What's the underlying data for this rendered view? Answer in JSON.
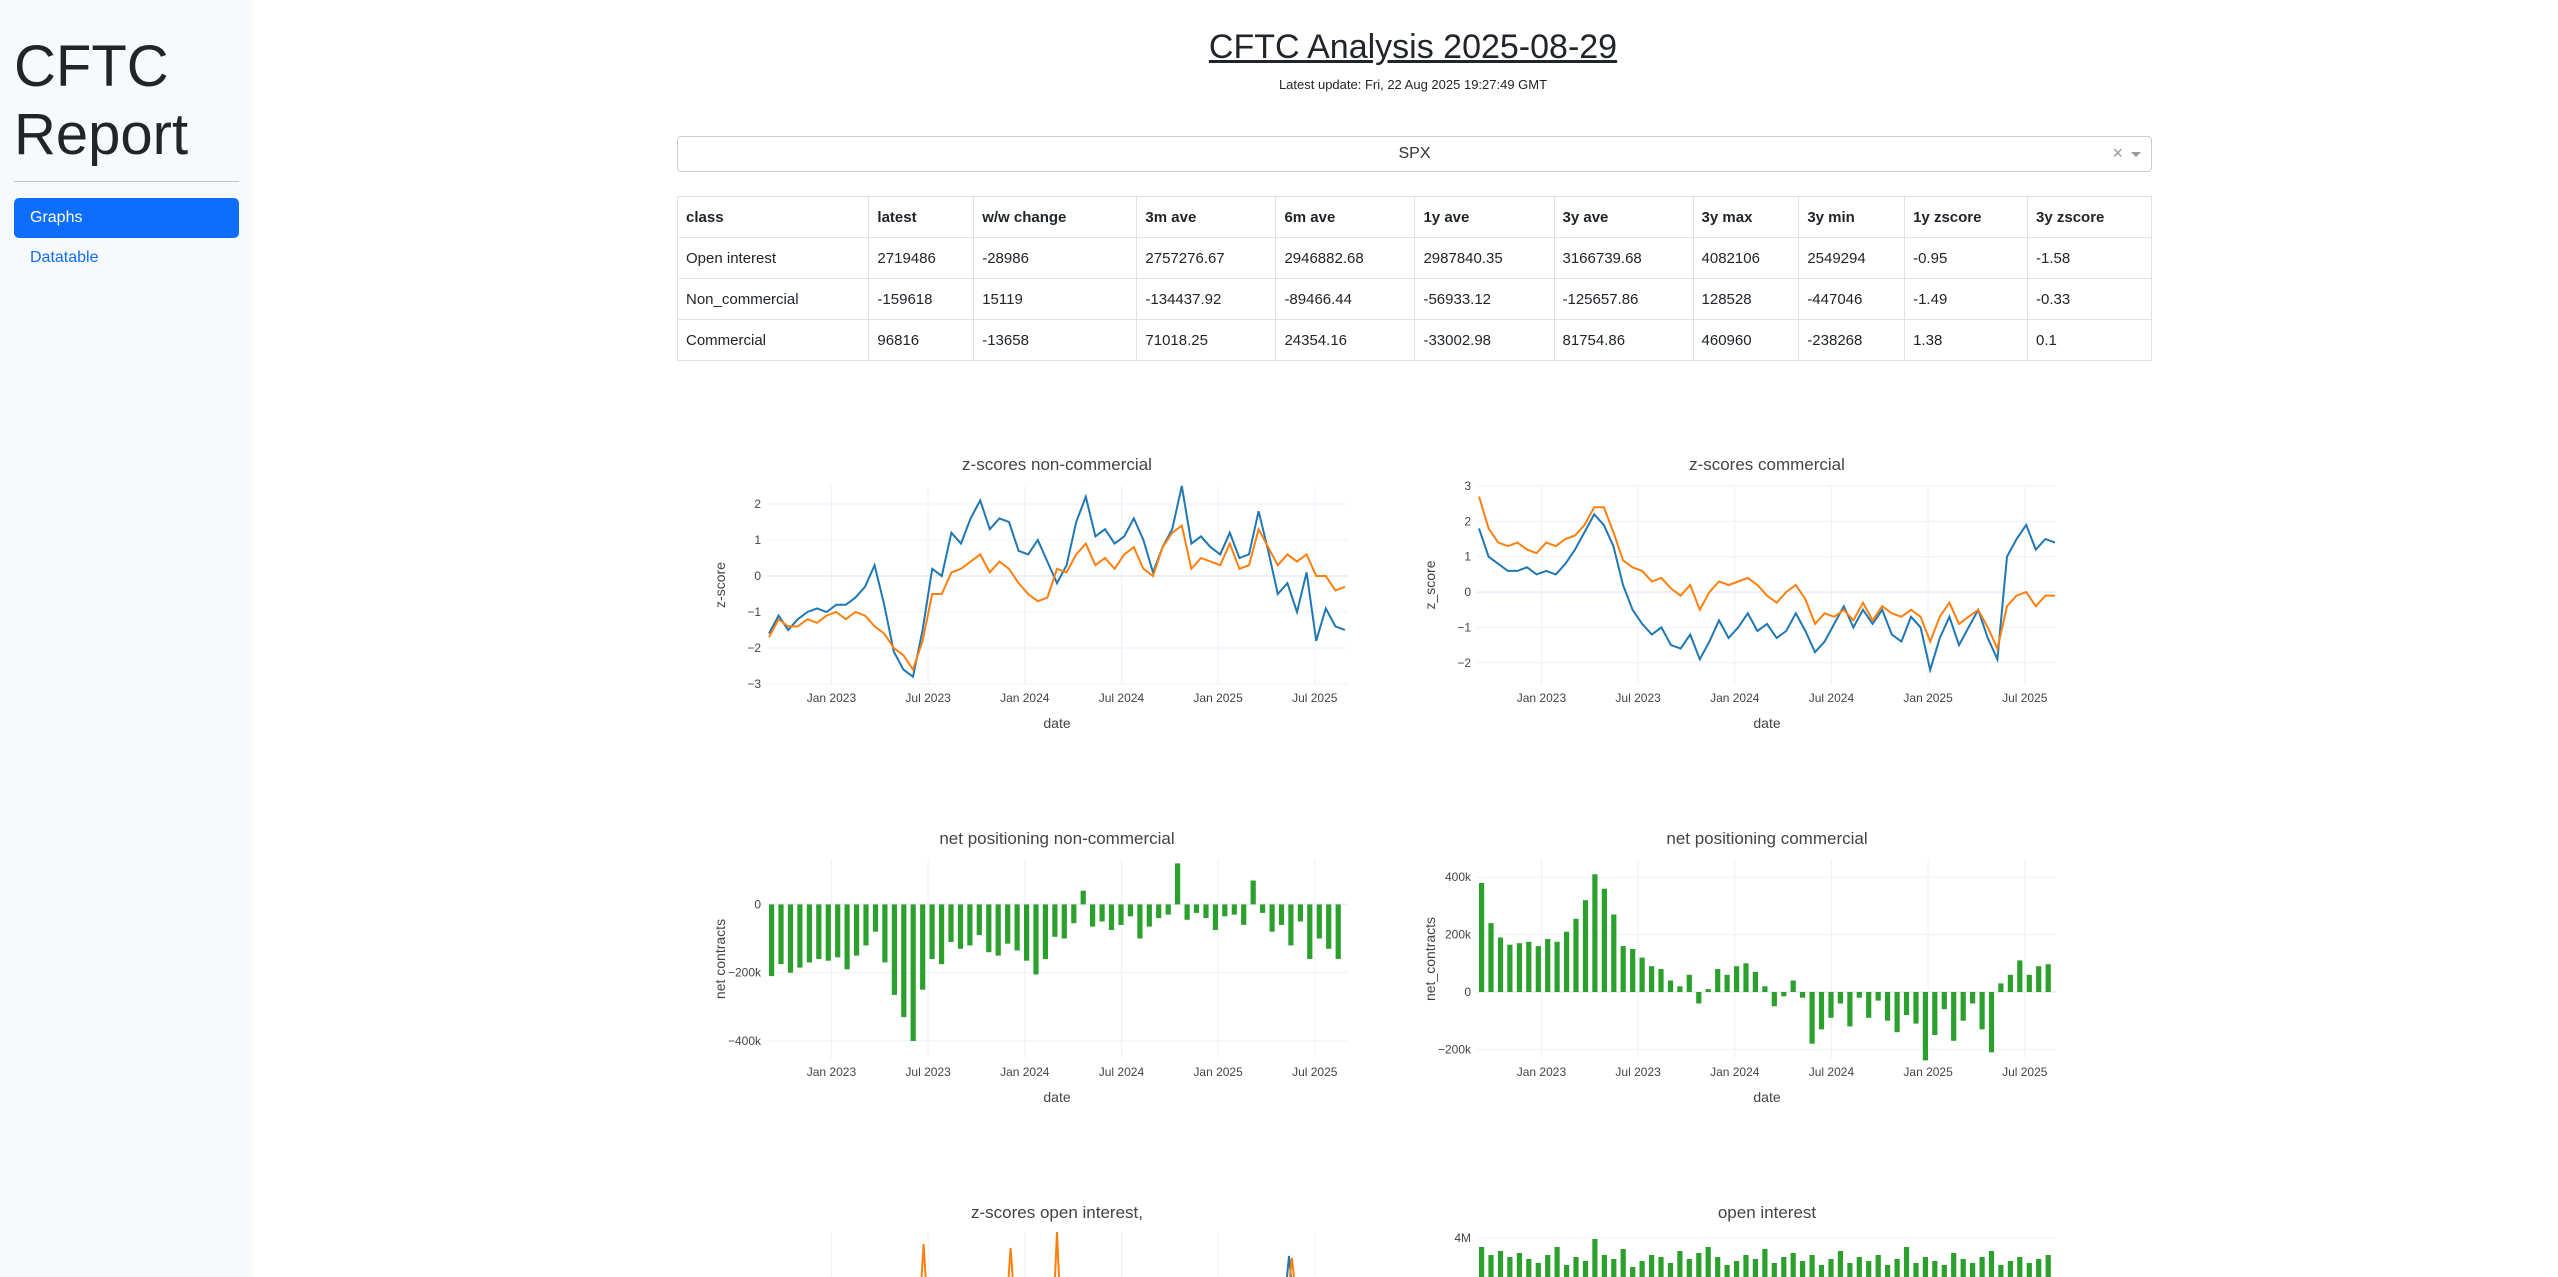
{
  "sidebar": {
    "brand_line1": "CFTC",
    "brand_line2": "Report",
    "items": [
      {
        "label": "Graphs",
        "active": true
      },
      {
        "label": "Datatable",
        "active": false
      }
    ]
  },
  "header": {
    "title": "CFTC Analysis 2025-08-29",
    "subtitle": "Latest update: Fri, 22 Aug 2025 19:27:49 GMT"
  },
  "selector": {
    "value": "SPX",
    "clear": "×"
  },
  "table": {
    "columns": [
      "class",
      "latest",
      "w/w change",
      "3m ave",
      "6m ave",
      "1y ave",
      "3y ave",
      "3y max",
      "3y min",
      "1y zscore",
      "3y zscore"
    ],
    "rows": [
      [
        "Open interest",
        "2719486",
        "-28986",
        "2757276.67",
        "2946882.68",
        "2987840.35",
        "3166739.68",
        "4082106",
        "2549294",
        "-0.95",
        "-1.58"
      ],
      [
        "Non_commercial",
        "-159618",
        "15119",
        "-134437.92",
        "-89466.44",
        "-56933.12",
        "-125657.86",
        "128528",
        "-447046",
        "-1.49",
        "-0.33"
      ],
      [
        "Commercial",
        "96816",
        "-13658",
        "71018.25",
        "24354.16",
        "-33002.98",
        "81754.86",
        "460960",
        "-238268",
        "1.38",
        "0.1"
      ]
    ]
  },
  "colors": {
    "blue": "#1f77b4",
    "orange": "#ff7f0e",
    "green": "#2ca02c",
    "primary": "#0d6efd"
  },
  "chart_data": [
    {
      "type": "line",
      "title": "z-scores non-commercial",
      "xlabel": "date",
      "ylabel": "z-score",
      "ylim": [
        -3,
        2.5
      ],
      "yticks": [
        -3,
        -2,
        -1,
        0,
        1,
        2
      ],
      "ytick_labels": [
        "−3",
        "−2",
        "−1",
        "0",
        "1",
        "2"
      ],
      "xtick_labels": [
        "Jan 2023",
        "Jul 2023",
        "Jan 2024",
        "Jul 2024",
        "Jan 2025",
        "Jul 2025"
      ],
      "xrange": [
        "2022-09",
        "2025-09"
      ],
      "series": [
        {
          "color": "#1f77b4",
          "values": [
            -1.6,
            -1.1,
            -1.5,
            -1.2,
            -1.0,
            -0.9,
            -1.0,
            -0.8,
            -0.8,
            -0.6,
            -0.3,
            0.3,
            -0.8,
            -2.1,
            -2.6,
            -2.8,
            -1.5,
            0.2,
            0.0,
            1.2,
            0.9,
            1.6,
            2.1,
            1.3,
            1.6,
            1.5,
            0.7,
            0.6,
            1.0,
            0.4,
            -0.2,
            0.3,
            1.5,
            2.2,
            1.1,
            1.3,
            0.9,
            1.1,
            1.6,
            1.0,
            0.1,
            0.8,
            1.3,
            2.5,
            0.9,
            1.1,
            0.8,
            0.6,
            1.2,
            0.5,
            0.6,
            1.8,
            0.7,
            -0.5,
            -0.2,
            -1.0,
            0.1,
            -1.8,
            -0.9,
            -1.4,
            -1.5
          ]
        },
        {
          "color": "#ff7f0e",
          "values": [
            -1.7,
            -1.2,
            -1.4,
            -1.4,
            -1.2,
            -1.3,
            -1.1,
            -1.0,
            -1.2,
            -1.0,
            -1.1,
            -1.4,
            -1.6,
            -2.0,
            -2.2,
            -2.6,
            -1.8,
            -0.5,
            -0.5,
            0.1,
            0.2,
            0.4,
            0.6,
            0.1,
            0.4,
            0.2,
            -0.2,
            -0.5,
            -0.7,
            -0.6,
            0.2,
            0.1,
            0.6,
            0.9,
            0.3,
            0.5,
            0.2,
            0.6,
            0.8,
            0.2,
            0.0,
            0.8,
            1.2,
            1.4,
            0.2,
            0.5,
            0.4,
            0.3,
            0.9,
            0.2,
            0.3,
            1.3,
            0.8,
            0.3,
            0.6,
            0.4,
            0.6,
            0.0,
            0.0,
            -0.4,
            -0.3
          ]
        }
      ]
    },
    {
      "type": "line",
      "title": "z-scores commercial",
      "xlabel": "date",
      "ylabel": "z_score",
      "ylim": [
        -2.6,
        3
      ],
      "yticks": [
        -2,
        -1,
        0,
        1,
        2,
        3
      ],
      "ytick_labels": [
        "−2",
        "−1",
        "0",
        "1",
        "2",
        "3"
      ],
      "xtick_labels": [
        "Jan 2023",
        "Jul 2023",
        "Jan 2024",
        "Jul 2024",
        "Jan 2025",
        "Jul 2025"
      ],
      "xrange": [
        "2022-09",
        "2025-09"
      ],
      "series": [
        {
          "color": "#1f77b4",
          "values": [
            1.8,
            1.0,
            0.8,
            0.6,
            0.6,
            0.7,
            0.5,
            0.6,
            0.5,
            0.8,
            1.2,
            1.7,
            2.2,
            1.9,
            1.3,
            0.2,
            -0.5,
            -0.9,
            -1.2,
            -1.0,
            -1.5,
            -1.6,
            -1.2,
            -1.9,
            -1.4,
            -0.8,
            -1.3,
            -1.0,
            -0.6,
            -1.1,
            -0.9,
            -1.3,
            -1.1,
            -0.6,
            -1.1,
            -1.7,
            -1.4,
            -0.9,
            -0.4,
            -1.0,
            -0.5,
            -0.9,
            -0.5,
            -1.2,
            -1.4,
            -0.7,
            -1.0,
            -2.2,
            -1.3,
            -0.7,
            -1.5,
            -1.0,
            -0.5,
            -1.3,
            -1.9,
            1.0,
            1.5,
            1.9,
            1.2,
            1.5,
            1.4
          ]
        },
        {
          "color": "#ff7f0e",
          "values": [
            2.7,
            1.8,
            1.4,
            1.3,
            1.4,
            1.2,
            1.1,
            1.4,
            1.3,
            1.5,
            1.6,
            1.9,
            2.4,
            2.4,
            1.7,
            0.9,
            0.7,
            0.6,
            0.3,
            0.4,
            0.1,
            -0.1,
            0.2,
            -0.5,
            0.0,
            0.3,
            0.2,
            0.3,
            0.4,
            0.2,
            -0.1,
            -0.3,
            0.0,
            0.2,
            -0.2,
            -0.9,
            -0.6,
            -0.7,
            -0.5,
            -0.8,
            -0.3,
            -0.8,
            -0.4,
            -0.6,
            -0.7,
            -0.5,
            -0.7,
            -1.4,
            -0.7,
            -0.3,
            -0.9,
            -0.7,
            -0.5,
            -1.0,
            -1.6,
            -0.4,
            -0.1,
            0.0,
            -0.4,
            -0.1,
            -0.1
          ]
        }
      ]
    },
    {
      "type": "bar",
      "title": "net positioning non-commercial",
      "xlabel": "date",
      "ylabel": "net contracts",
      "ylim": [
        -450000,
        130000
      ],
      "yticks": [
        -400000,
        -200000,
        0
      ],
      "ytick_labels": [
        "−400k",
        "−200k",
        "0"
      ],
      "xtick_labels": [
        "Jan 2023",
        "Jul 2023",
        "Jan 2024",
        "Jul 2024",
        "Jan 2025",
        "Jul 2025"
      ],
      "xrange": [
        "2022-09",
        "2025-09"
      ],
      "series": [
        {
          "color": "#2ca02c",
          "values": [
            -210000,
            -175000,
            -200000,
            -185000,
            -170000,
            -160000,
            -165000,
            -155000,
            -190000,
            -150000,
            -120000,
            -80000,
            -170000,
            -265000,
            -330000,
            -400000,
            -250000,
            -160000,
            -175000,
            -110000,
            -130000,
            -120000,
            -90000,
            -140000,
            -150000,
            -115000,
            -135000,
            -165000,
            -205000,
            -160000,
            -95000,
            -100000,
            -55000,
            40000,
            -65000,
            -50000,
            -75000,
            -60000,
            -35000,
            -100000,
            -65000,
            -40000,
            -30000,
            120000,
            -45000,
            -25000,
            -40000,
            -75000,
            -35000,
            -30000,
            -60000,
            70000,
            -25000,
            -80000,
            -60000,
            -120000,
            -50000,
            -160000,
            -100000,
            -130000,
            -159618
          ]
        }
      ]
    },
    {
      "type": "bar",
      "title": "net positioning commercial",
      "xlabel": "date",
      "ylabel": "net_contracts",
      "ylim": [
        -230000,
        460000
      ],
      "yticks": [
        -200000,
        0,
        200000,
        400000
      ],
      "ytick_labels": [
        "−200k",
        "0",
        "200k",
        "400k"
      ],
      "xtick_labels": [
        "Jan 2023",
        "Jul 2023",
        "Jan 2024",
        "Jul 2024",
        "Jan 2025",
        "Jul 2025"
      ],
      "xrange": [
        "2022-09",
        "2025-09"
      ],
      "series": [
        {
          "color": "#2ca02c",
          "values": [
            380000,
            240000,
            190000,
            165000,
            170000,
            175000,
            160000,
            185000,
            175000,
            210000,
            255000,
            320000,
            410000,
            360000,
            270000,
            160000,
            150000,
            120000,
            90000,
            80000,
            40000,
            20000,
            60000,
            -40000,
            10000,
            80000,
            60000,
            90000,
            100000,
            70000,
            20000,
            -50000,
            -15000,
            40000,
            -20000,
            -180000,
            -130000,
            -90000,
            -40000,
            -120000,
            -20000,
            -90000,
            -30000,
            -100000,
            -140000,
            -80000,
            -110000,
            -238268,
            -150000,
            -60000,
            -170000,
            -100000,
            -40000,
            -130000,
            -210000,
            30000,
            60000,
            110000,
            60000,
            90000,
            96816
          ]
        }
      ]
    }
  ],
  "partial_charts": [
    {
      "title": "z-scores open interest,"
    },
    {
      "title": "open interest",
      "ytick_label": "4M"
    }
  ]
}
